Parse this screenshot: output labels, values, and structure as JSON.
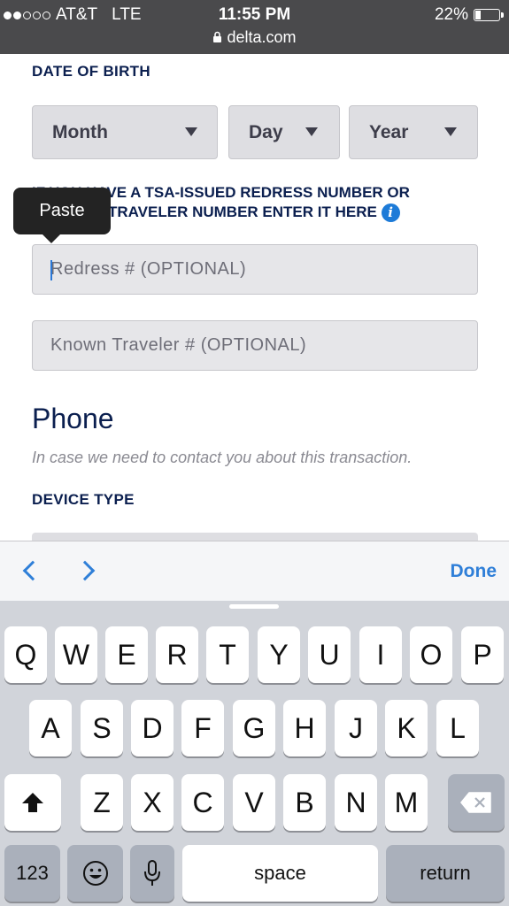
{
  "status_bar": {
    "carrier": "AT&T",
    "network": "LTE",
    "time": "11:55 PM",
    "url": "delta.com",
    "battery": "22%"
  },
  "form": {
    "dob_label": "DATE OF BIRTH",
    "month": "Month",
    "day": "Day",
    "year": "Year",
    "tsa_text": "IF YOU HAVE A TSA-ISSUED REDRESS NUMBER OR KNOWN TRAVELER NUMBER ENTER IT HERE",
    "tsa_visible_line1": "IF YOU HAVE A TSA-ISSUED REDRESS NUMBER OR",
    "tsa_visible_line2": "TRAVELER NUMBER ENTER IT HERE",
    "paste_label": "Paste",
    "redress_placeholder": "Redress # (OPTIONAL)",
    "known_traveler_placeholder": "Known Traveler # (OPTIONAL)",
    "phone_heading": "Phone",
    "phone_subtext": "In case we need to contact you about this transaction.",
    "device_type_label": "DEVICE TYPE"
  },
  "accessory_bar": {
    "done_label": "Done"
  },
  "keyboard": {
    "row1": [
      "Q",
      "W",
      "E",
      "R",
      "T",
      "Y",
      "U",
      "I",
      "O",
      "P"
    ],
    "row2": [
      "A",
      "S",
      "D",
      "F",
      "G",
      "H",
      "J",
      "K",
      "L"
    ],
    "row3": [
      "Z",
      "X",
      "C",
      "V",
      "B",
      "N",
      "M"
    ],
    "numbers_label": "123",
    "space_label": "space",
    "return_label": "return"
  },
  "colors": {
    "accent": "#2f7fd8",
    "navy": "#0b1f4f",
    "info_icon": "#1d7bd8"
  }
}
